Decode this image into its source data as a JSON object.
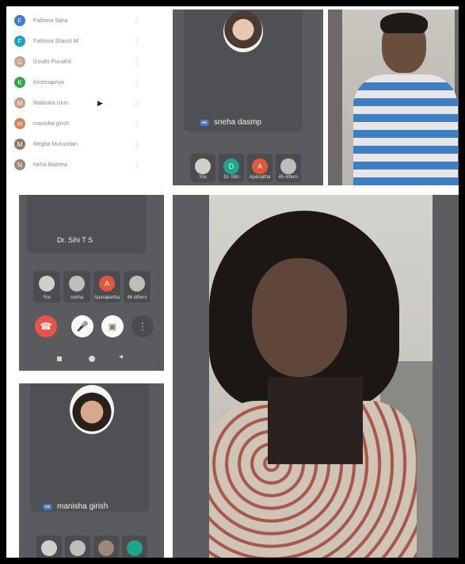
{
  "participant_list": [
    {
      "name": "Fathima Sana",
      "initial": "F",
      "color": "#3b7dd8"
    },
    {
      "name": "Fathima Shamil M",
      "initial": "F",
      "color": "#19a2c4"
    },
    {
      "name": "Gouthi Punathil",
      "initial": "G",
      "color": "#cba28e"
    },
    {
      "name": "Krishnapriya",
      "initial": "K",
      "color": "#3aa44a"
    },
    {
      "name": "Malavika Unni",
      "initial": "M",
      "color": "#c3a08c"
    },
    {
      "name": "manisha girish",
      "initial": "m",
      "color": "#c98a5e"
    },
    {
      "name": "Megha Mukundan",
      "initial": "M",
      "color": "#8c7a6a"
    },
    {
      "name": "Neha Mathew",
      "initial": "N",
      "color": "#a08878"
    }
  ],
  "call_top": {
    "speaker_name": "sneha dasmp",
    "tiles": [
      {
        "label": "You",
        "initial": "",
        "color": "#cfcfcf"
      },
      {
        "label": "Dr. Sihi",
        "initial": "D",
        "color": "#1fa58c"
      },
      {
        "label": "Aparajitha",
        "initial": "A",
        "color": "#e2563a"
      },
      {
        "label": "45 others",
        "initial": "",
        "color": "#bdbdbd"
      }
    ]
  },
  "call_mid": {
    "speaker_name": "Dr. Sihi T S",
    "tiles": [
      {
        "label": "You",
        "initial": "",
        "color": "#cfcfcf"
      },
      {
        "label": "sneha",
        "initial": "",
        "color": "#bdbdbd"
      },
      {
        "label": "Aparajeetha",
        "initial": "A",
        "color": "#e2563a"
      },
      {
        "label": "46 others",
        "initial": "",
        "color": "#bdbdbd"
      }
    ]
  },
  "call_bottom": {
    "speaker_name": "manisha girish",
    "tiles": [
      {
        "label": "",
        "initial": "",
        "color": "#cfcfcf"
      },
      {
        "label": "",
        "initial": "",
        "color": "#bdbdbd"
      },
      {
        "label": "",
        "initial": "",
        "color": "#a08878"
      },
      {
        "label": "",
        "initial": "",
        "color": "#1fa58c"
      }
    ]
  },
  "colors": {
    "panel_bg": "#5a5b5e",
    "end_call": "#e8534a",
    "camera_badge": "#4a7bd0"
  },
  "icons": [
    "chevron-right-icon",
    "end-call-icon",
    "mic-icon",
    "camera-icon",
    "more-icon",
    "square-nav-icon",
    "circle-nav-icon",
    "back-nav-icon"
  ]
}
